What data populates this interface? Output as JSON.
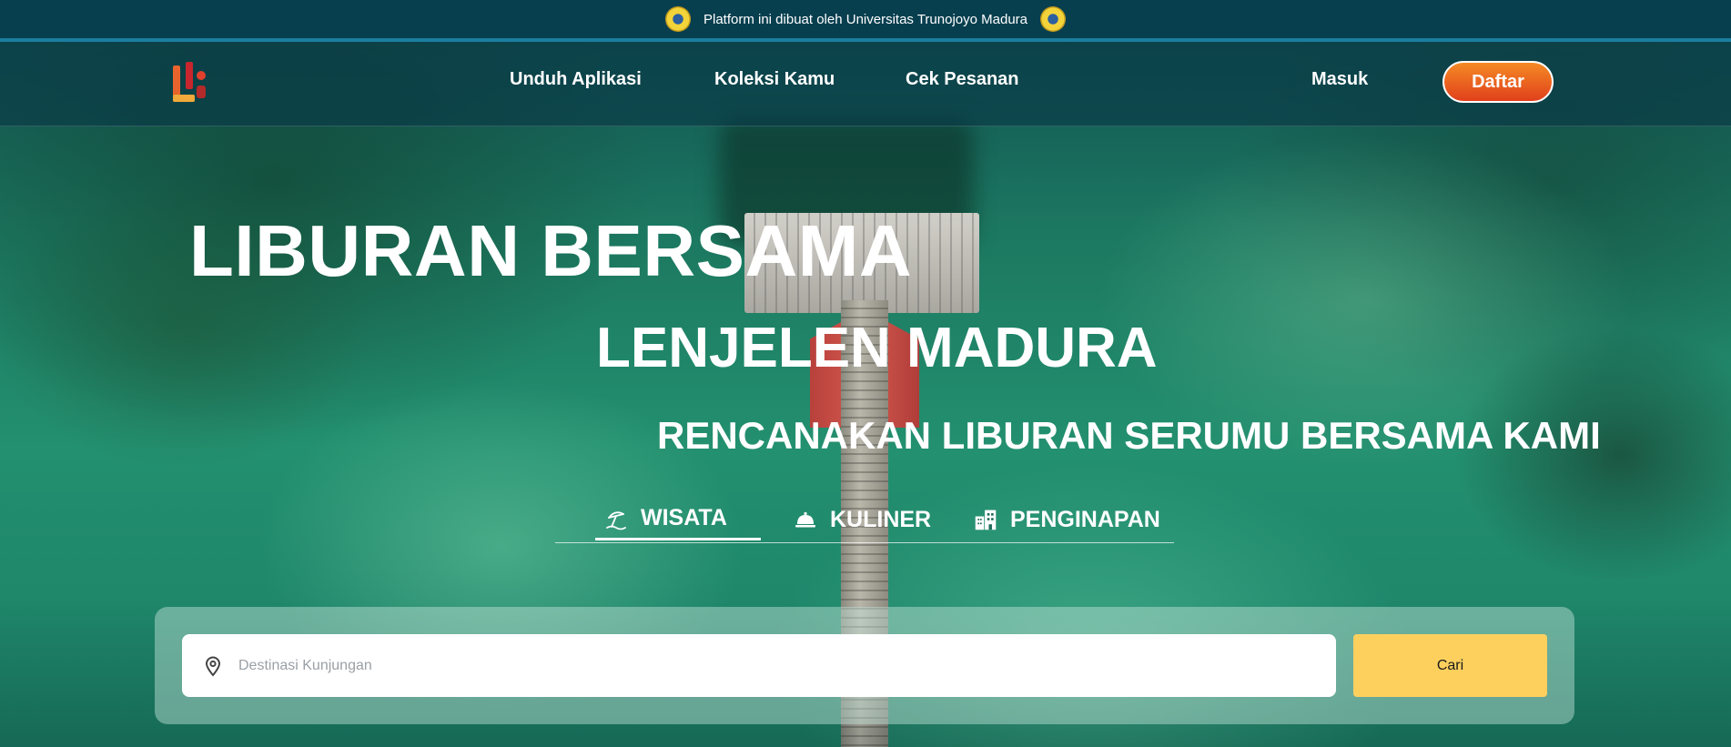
{
  "topbar": {
    "text": "Platform ini dibuat oleh Universitas Trunojoyo Madura",
    "left_icon": "university-seal-icon",
    "right_icon": "university-seal-icon"
  },
  "navbar": {
    "logo_icon": "lenjelen-logo-icon",
    "links": [
      "Unduh Aplikasi",
      "Koleksi Kamu",
      "Cek Pesanan"
    ],
    "login_label": "Masuk",
    "register_label": "Daftar"
  },
  "hero": {
    "headline1": "LIBURAN BERSAMA",
    "headline2": "LENJELEN MADURA",
    "tagline": "RENCANAKAN LIBURAN SERUMU BERSAMA KAMI"
  },
  "tabs": [
    {
      "label": "WISATA",
      "icon": "beach-umbrella-icon",
      "active": true
    },
    {
      "label": "KULINER",
      "icon": "food-cloche-icon",
      "active": false
    },
    {
      "label": "PENGINAPAN",
      "icon": "hotel-building-icon",
      "active": false
    }
  ],
  "search": {
    "placeholder": "Destinasi Kunjungan",
    "value": "",
    "icon": "map-pin-icon",
    "button_label": "Cari"
  },
  "colors": {
    "topbar_bg": "#083f4f",
    "topbar_border": "#1c7ea0",
    "register_gradient_start": "#f58a24",
    "register_gradient_end": "#e0401c",
    "search_button": "#fdd05e"
  }
}
